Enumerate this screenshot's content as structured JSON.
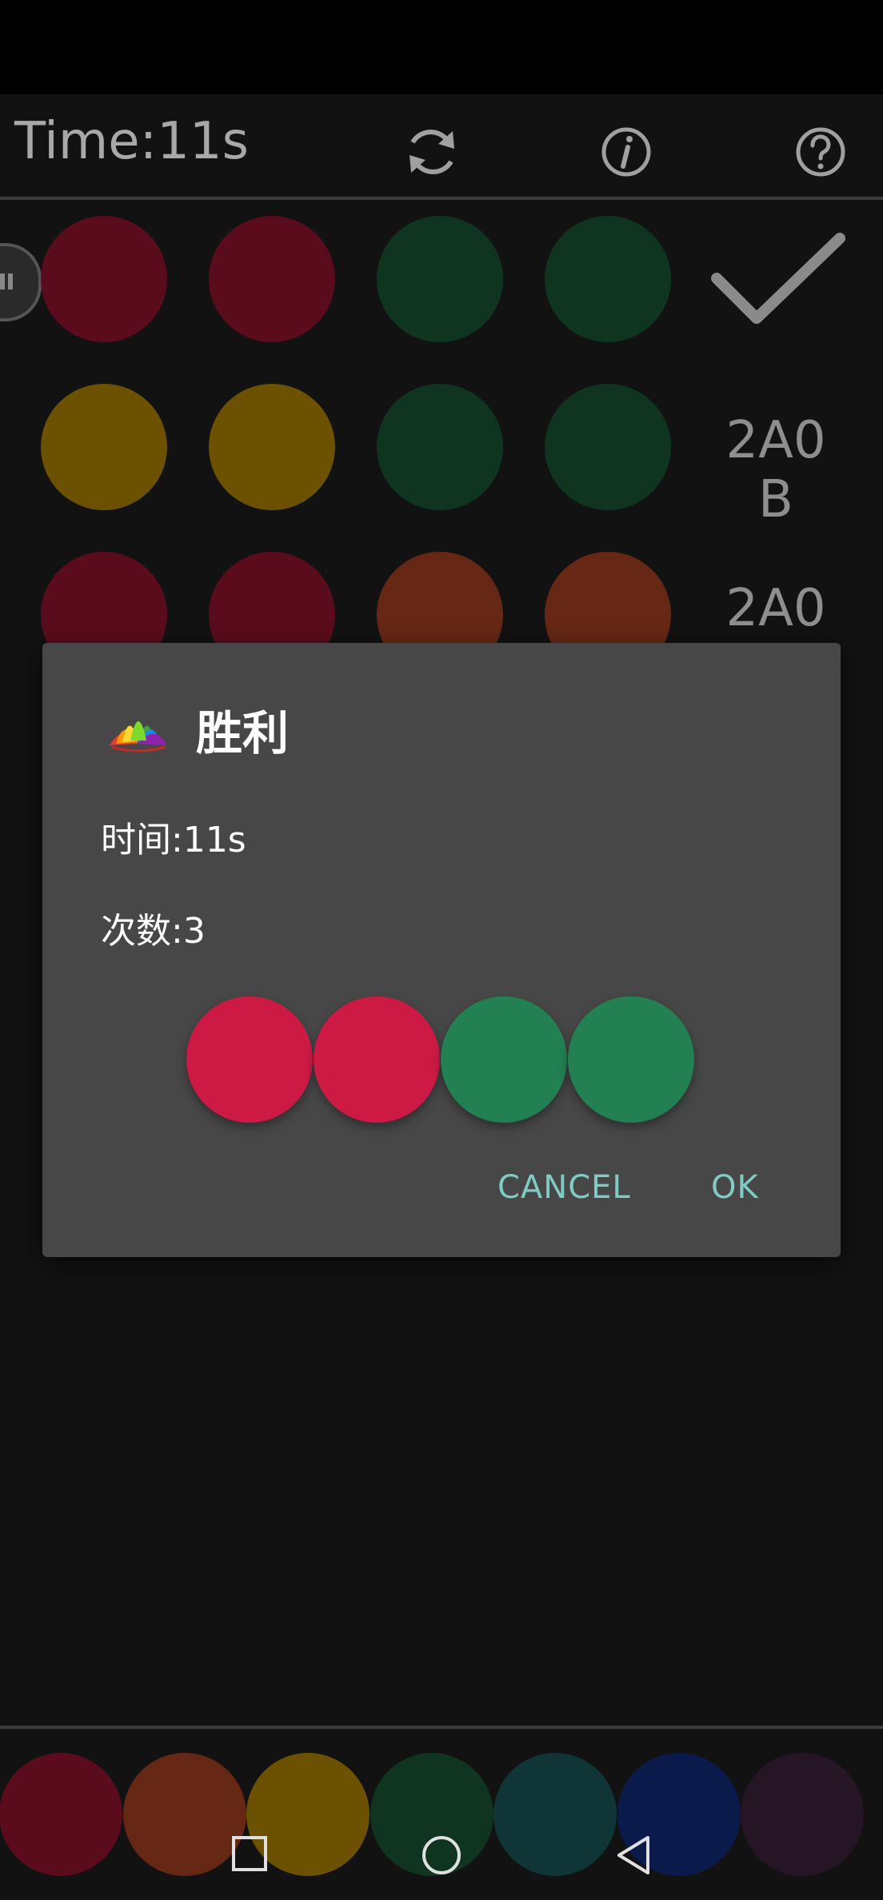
{
  "header": {
    "time_label": "Time:11s",
    "icons": [
      "refresh-icon",
      "info-icon",
      "help-icon"
    ]
  },
  "board": {
    "rows": [
      {
        "pegs": [
          "#5a0c1c",
          "#5a0c1c",
          "#0f3520",
          "#0f3520"
        ],
        "result": "",
        "result_icon": "check-icon"
      },
      {
        "pegs": [
          "#6b5100",
          "#6b5100",
          "#0f3520",
          "#0f3520"
        ],
        "result_line1": "2A0",
        "result_line2": "B"
      },
      {
        "pegs": [
          "#5a0c1c",
          "#5a0c1c",
          "#662814",
          "#662814"
        ],
        "result_line1": "2A0",
        "result_line2": ""
      }
    ]
  },
  "dialog": {
    "title": "胜利",
    "time_line": "时间:11s",
    "count_line": "次数:3",
    "answer_pegs": [
      "#cc1a45",
      "#cc1a45",
      "#238052",
      "#238052"
    ],
    "cancel_label": "CANCEL",
    "ok_label": "OK"
  },
  "palette": {
    "colors": [
      "#5a0c1c",
      "#662814",
      "#6b5100",
      "#0f3520",
      "#103536",
      "#0a1a4a",
      "#261525"
    ]
  },
  "navbar": {
    "icons": [
      "recent-apps-icon",
      "home-icon",
      "back-icon"
    ]
  },
  "colors": {
    "accent": "#80cbc4",
    "dialog_bg": "#474747"
  }
}
